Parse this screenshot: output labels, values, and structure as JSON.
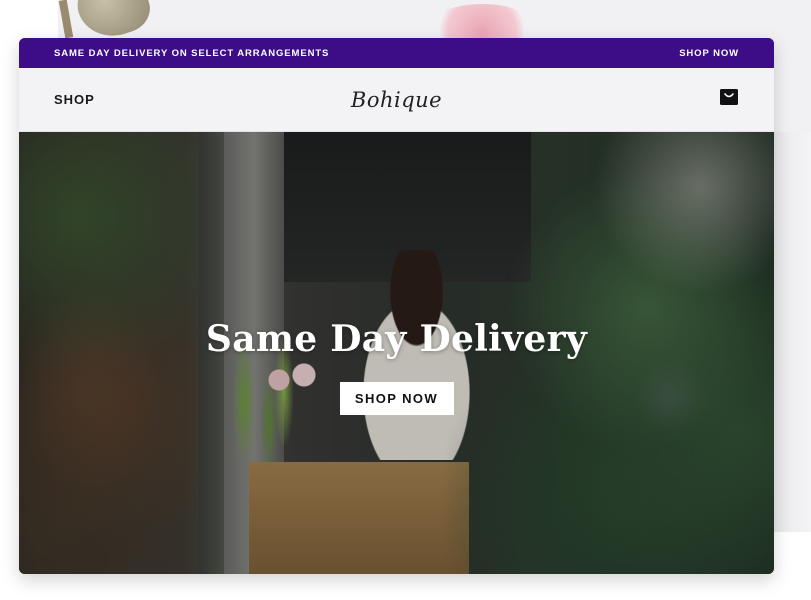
{
  "announcement": {
    "text": "SAME DAY DELIVERY ON SELECT ARRANGEMENTS",
    "cta": "SHOP NOW"
  },
  "header": {
    "shop_label": "SHOP",
    "logo_text": "Bohique",
    "cart_icon": "shopping-bag-icon"
  },
  "hero": {
    "title": "Same Day Delivery",
    "cta": "SHOP NOW"
  },
  "colors": {
    "announcement_bg": "#3d0d87",
    "header_bg": "#f3f3f6",
    "cta_bg": "#ffffff"
  }
}
